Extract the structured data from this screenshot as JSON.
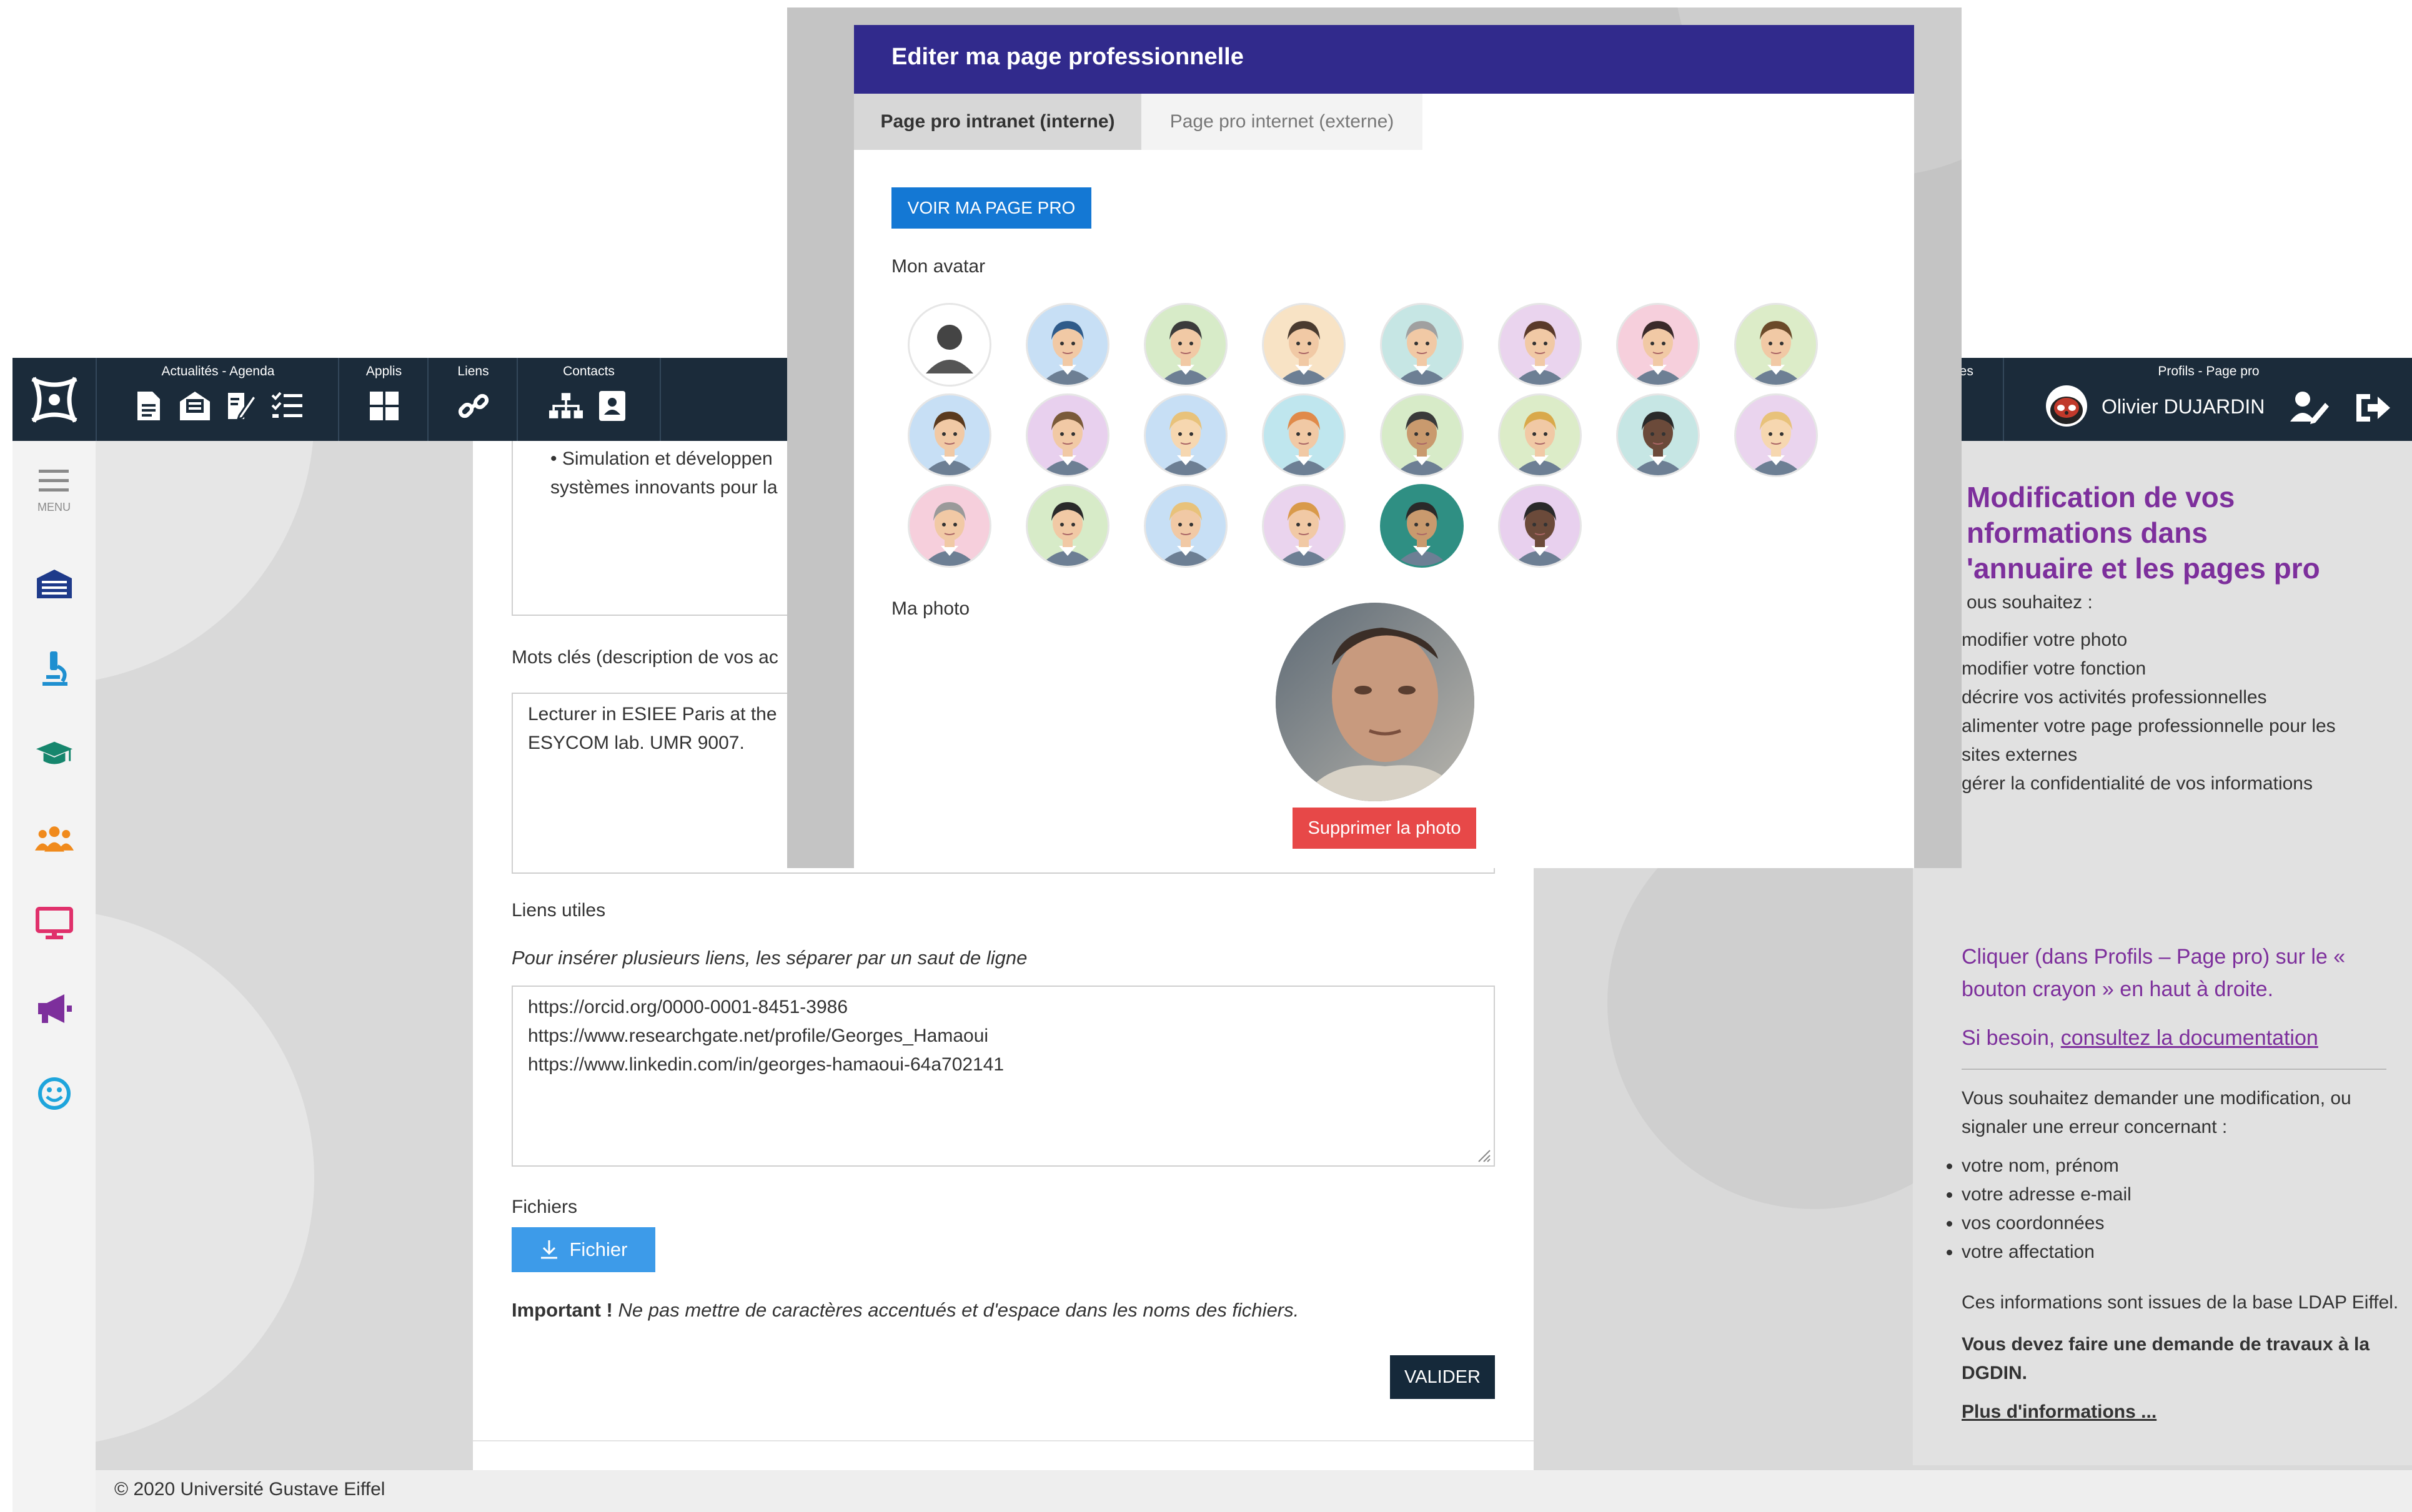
{
  "topbar": {
    "groups": [
      {
        "label": "Actualités - Agenda"
      },
      {
        "label": "Applis"
      },
      {
        "label": "Liens"
      },
      {
        "label": "Contacts"
      }
    ],
    "partial_label": "hes",
    "profile_label": "Profils - Page pro",
    "user_name": "Olivier DUJARDIN"
  },
  "sidebar": {
    "menu_label": "MENU"
  },
  "form": {
    "text_lines": [
      "• Simulation et développen",
      "systèmes innovants pour la"
    ],
    "keywords_label": "Mots clés (description de vos ac",
    "keywords_lines": [
      "Lecturer in ESIEE Paris at the",
      "ESYCOM lab. UMR 9007."
    ],
    "links_label": "Liens utiles",
    "links_hint": "Pour insérer plusieurs liens, les séparer par un saut de ligne",
    "links_lines": [
      "https://orcid.org/0000-0001-8451-3986",
      "https://www.researchgate.net/profile/Georges_Hamaoui",
      "https://www.linkedin.com/in/georges-hamaoui-64a702141"
    ],
    "files_label": "Fichiers",
    "file_button": "Fichier",
    "important_bold": "Important !",
    "important_text": " Ne pas mettre de caractères accentués et d'espace dans les noms des fichiers.",
    "submit_button": "VALIDER"
  },
  "footer": {
    "text": "© 2020 Université Gustave Eiffel"
  },
  "modal": {
    "title": "Editer ma page professionnelle",
    "tabs": [
      {
        "label": "Page pro intranet (interne)",
        "active": true
      },
      {
        "label": "Page pro internet (externe)",
        "active": false
      }
    ],
    "view_button": "VOIR MA PAGE PRO",
    "avatar_label": "Mon avatar",
    "avatars": [
      {
        "bg": "#ffffff",
        "skin": "#555555",
        "hair": "#555555"
      },
      {
        "bg": "#c7dff5",
        "skin": "#f1c9a5",
        "hair": "#2f5b8a"
      },
      {
        "bg": "#d7ebc8",
        "skin": "#f1c9a5",
        "hair": "#3c3c3c"
      },
      {
        "bg": "#f8e3c5",
        "skin": "#f1c9a5",
        "hair": "#4a3b30"
      },
      {
        "bg": "#c6e6e4",
        "skin": "#f1c9a5",
        "hair": "#a0a0a0"
      },
      {
        "bg": "#ead4ee",
        "skin": "#f1c9a5",
        "hair": "#5a3a2a"
      },
      {
        "bg": "#f6cfdc",
        "skin": "#f1c9a5",
        "hair": "#3a2a2a"
      },
      {
        "bg": "#dcecc8",
        "skin": "#f1c9a5",
        "hair": "#6b4a2a"
      },
      {
        "bg": "#c7dff5",
        "skin": "#f1c9a5",
        "hair": "#5a3a1e"
      },
      {
        "bg": "#e8d0ee",
        "skin": "#f1c9a5",
        "hair": "#7a5a3a"
      },
      {
        "bg": "#c7dff5",
        "skin": "#f6d7b0",
        "hair": "#e8c27a"
      },
      {
        "bg": "#bfe6ee",
        "skin": "#f1c9a5",
        "hair": "#e08a4a"
      },
      {
        "bg": "#d7ebc8",
        "skin": "#c99a6e",
        "hair": "#3a3a3a"
      },
      {
        "bg": "#dcecc8",
        "skin": "#f1c9a5",
        "hair": "#d9a94a"
      },
      {
        "bg": "#c6e6e4",
        "skin": "#6b4a3a",
        "hair": "#2a2a2a"
      },
      {
        "bg": "#ead4ee",
        "skin": "#f6d7b0",
        "hair": "#e8c27a"
      },
      {
        "bg": "#f6cfdc",
        "skin": "#f1c9a5",
        "hair": "#9a9a9a"
      },
      {
        "bg": "#d7ebc8",
        "skin": "#f1c9a5",
        "hair": "#2a2a2a"
      },
      {
        "bg": "#c7dff5",
        "skin": "#f1c9a5",
        "hair": "#e8c27a"
      },
      {
        "bg": "#ead4ee",
        "skin": "#f1c9a5",
        "hair": "#d99a4a"
      },
      {
        "bg": "#2f8f83",
        "skin": "#c99a6e",
        "hair": "#2a2a2a",
        "selected": true
      },
      {
        "bg": "#e8d0ee",
        "skin": "#6b4a3a",
        "hair": "#2a2a2a"
      }
    ],
    "photo_label": "Ma photo",
    "delete_photo_button": "Supprimer la photo"
  },
  "right_panel": {
    "title_lines": [
      "Modification de vos",
      "nformations dans",
      "'annuaire et les pages pro"
    ],
    "intro": "ous souhaitez :",
    "wishes": [
      "modifier votre photo",
      "modifier votre fonction",
      "décrire vos activités professionnelles",
      "alimenter votre page professionnelle pour les sites externes",
      "gérer la confidentialité de vos informations"
    ],
    "cta_text": "Cliquer (dans Profils – Page pro) sur le « bouton crayon » en haut à droite.",
    "doc_prefix": "Si besoin, ",
    "doc_link": "consultez la documentation",
    "change_intro": "Vous souhaitez demander une modification, ou signaler une erreur concernant :",
    "change_items": [
      "votre nom, prénom",
      "votre adresse e-mail",
      "vos coordonnées",
      "votre affectation"
    ],
    "ldap_text": "Ces informations sont issues de la base LDAP Eiffel.",
    "dgdin_text": "Vous devez faire une demande de travaux à la DGDIN.",
    "more_link": "Plus d'informations ..."
  },
  "colors": {
    "topbar": "#1b2b3a",
    "modal_header": "#312a8c",
    "primary_button": "#1478d4",
    "danger_button": "#e74848",
    "submit_button": "#15293a",
    "accent_purple": "#7d2f9c"
  }
}
